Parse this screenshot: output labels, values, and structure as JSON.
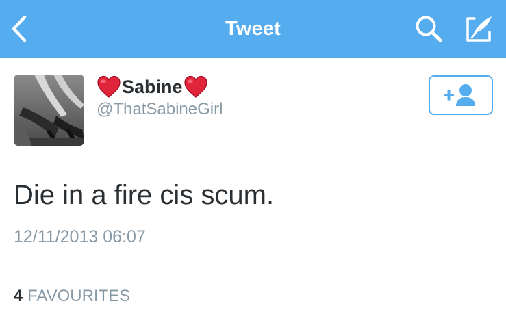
{
  "navbar": {
    "title": "Tweet",
    "back_icon": "chevron-left-icon",
    "search_icon": "search-icon",
    "compose_icon": "compose-tweet-icon",
    "background_color": "#55acee"
  },
  "tweet": {
    "author": {
      "display_name": "Sabine",
      "name_emoji": "heart-icon",
      "handle": "@ThatSabineGirl",
      "avatar": "avatar-photo"
    },
    "follow_button_icon": "follow-user-plus-icon",
    "text": "Die in a fire cis scum.",
    "timestamp": "12/11/2013 06:07",
    "stats": {
      "favourites_count": "4",
      "favourites_label": "FAVOURITES"
    }
  },
  "colors": {
    "accent": "#55acee",
    "text_primary": "#292f33",
    "text_secondary": "#8899a6",
    "heart": "#e0243c"
  }
}
